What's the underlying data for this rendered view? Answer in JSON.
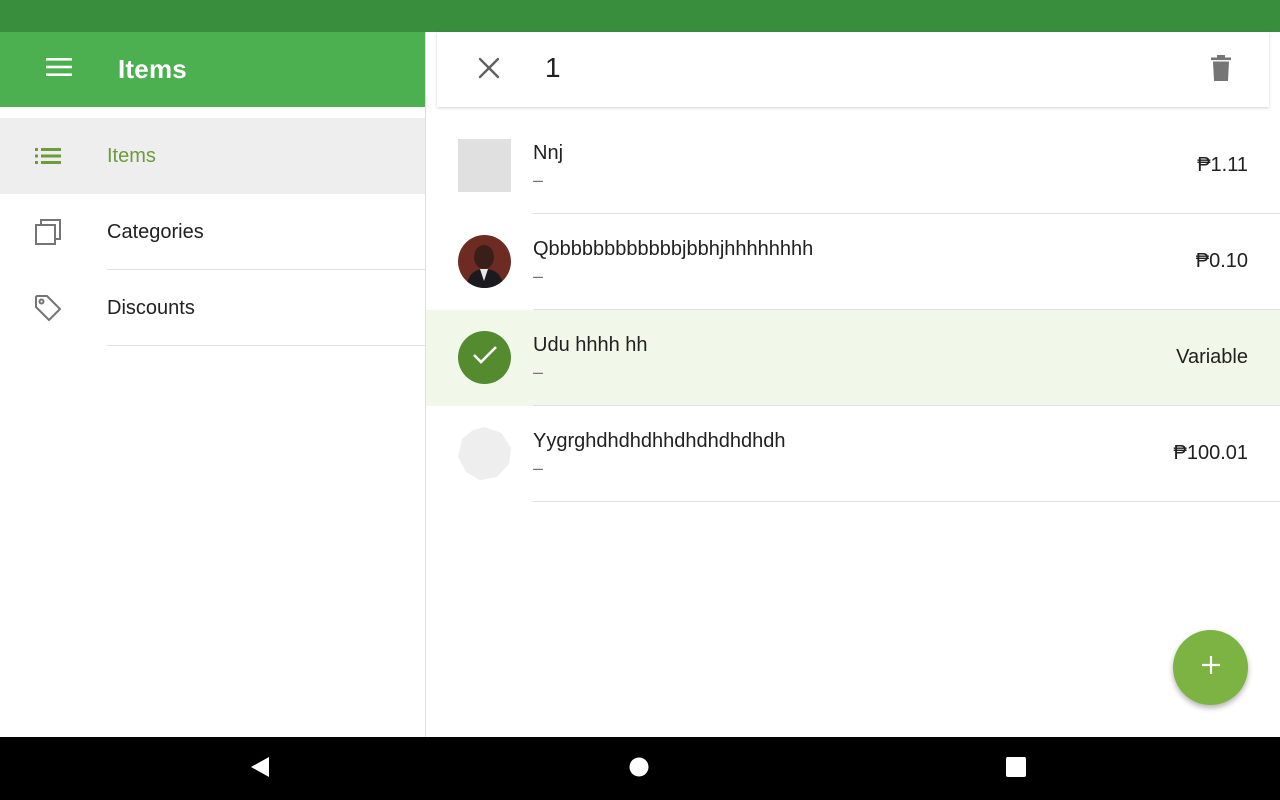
{
  "sidebar": {
    "title": "Items",
    "menu_icon": "menu-icon",
    "items": [
      {
        "label": "Items",
        "icon": "list-icon",
        "active": true
      },
      {
        "label": "Categories",
        "icon": "categories-icon",
        "active": false
      },
      {
        "label": "Discounts",
        "icon": "tag-icon",
        "active": false
      }
    ]
  },
  "action_bar": {
    "close_icon": "close-icon",
    "selection_count": "1",
    "delete_icon": "delete-icon"
  },
  "items": [
    {
      "name": "Nnj",
      "sub": "–",
      "price": "₱1.11",
      "thumb": "grey-square",
      "selected": false
    },
    {
      "name": "Qbbbbbbbbbbbbjbbhjhhhhhhhh",
      "sub": "–",
      "price": "₱0.10",
      "thumb": "photo",
      "selected": false
    },
    {
      "name": "Udu hhhh hh",
      "sub": "–",
      "price": "Variable",
      "thumb": "check",
      "selected": true
    },
    {
      "name": "Yygrghdhdhdhhdhdhdhdhdh",
      "sub": "–",
      "price": "₱100.01",
      "thumb": "octagon",
      "selected": false
    }
  ],
  "fab_icon": "add-icon",
  "system_nav": {
    "back": "back-icon",
    "home": "home-icon",
    "recents": "recents-icon"
  },
  "colors": {
    "primary": "#4caf50",
    "primary_dark": "#388e3c",
    "accent": "#7cb342",
    "selected_bg": "#f1f8e9",
    "check": "#558b2f"
  }
}
